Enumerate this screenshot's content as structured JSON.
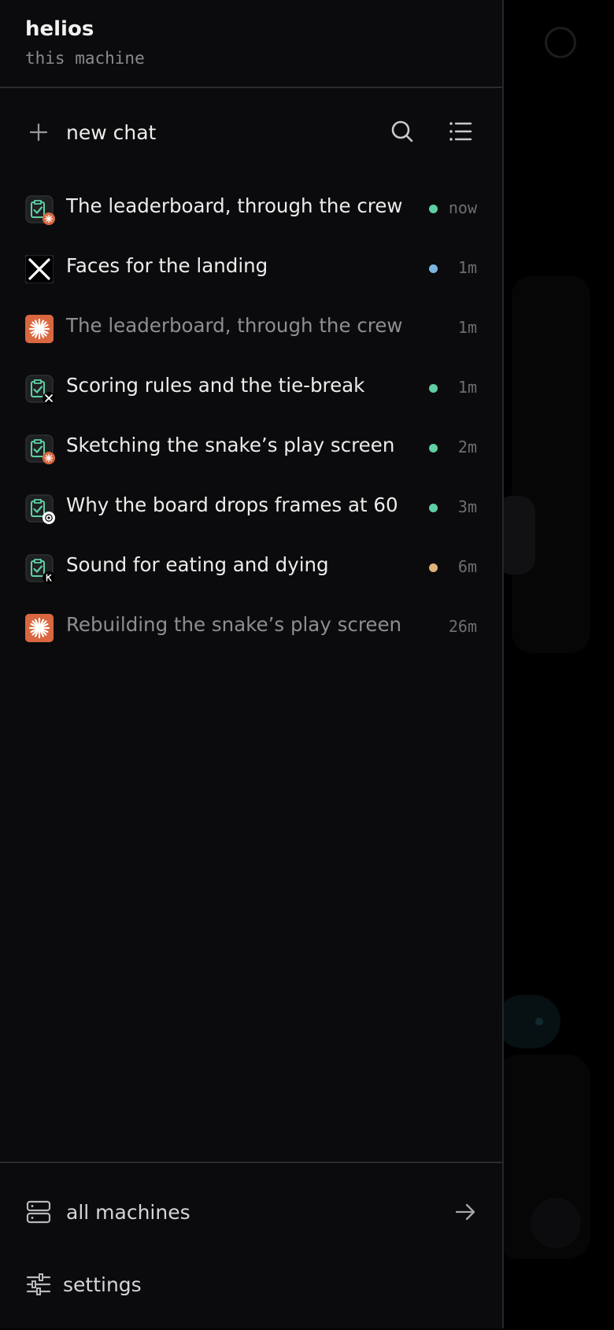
{
  "header": {
    "title": "helios",
    "subtitle": "this machine"
  },
  "actions": {
    "new_chat_label": "new chat",
    "search_icon": "search-icon",
    "list_icon": "list-icon"
  },
  "chats": [
    {
      "title": "The leaderboard, through the crew",
      "time": "now",
      "status_color": "#5ed0a3",
      "dim": false,
      "icon": "crew-icon",
      "badge": "claude-badge"
    },
    {
      "title": "Faces for the landing",
      "time": "1m",
      "status_color": "#7cb6e0",
      "dim": false,
      "icon": "x-icon",
      "badge": ""
    },
    {
      "title": "The leaderboard, through the crew",
      "time": "1m",
      "status_color": "",
      "dim": true,
      "icon": "claude-icon",
      "badge": ""
    },
    {
      "title": "Scoring rules and the tie-break",
      "time": "1m",
      "status_color": "#5ed0a3",
      "dim": false,
      "icon": "crew-icon",
      "badge": "x-badge"
    },
    {
      "title": "Sketching the snake’s play screen",
      "time": "2m",
      "status_color": "#5ed0a3",
      "dim": false,
      "icon": "crew-icon",
      "badge": "claude-badge"
    },
    {
      "title": "Why the board drops frames at 60",
      "time": "3m",
      "status_color": "#5ed0a3",
      "dim": false,
      "icon": "crew-icon",
      "badge": "openai-badge"
    },
    {
      "title": "Sound for eating and dying",
      "time": "6m",
      "status_color": "#e0b27a",
      "dim": false,
      "icon": "crew-icon",
      "badge": "k-badge"
    },
    {
      "title": "Rebuilding the snake’s play screen",
      "time": "26m",
      "status_color": "",
      "dim": true,
      "icon": "claude-icon",
      "badge": ""
    }
  ],
  "footer": {
    "machines_label": "all machines",
    "settings_label": "settings"
  },
  "colors": {
    "accent_green": "#5ed0a3",
    "claude_orange": "#d9673f",
    "background": "#0b0b0d"
  }
}
